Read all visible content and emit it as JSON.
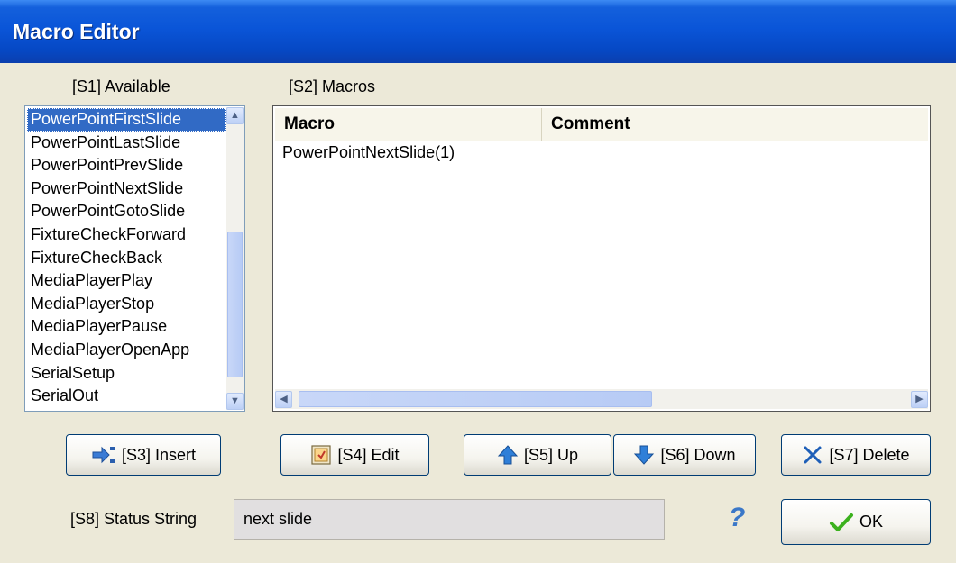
{
  "window": {
    "title": "Macro Editor"
  },
  "available": {
    "label": "[S1] Available",
    "items": [
      "PowerPointFirstSlide",
      "PowerPointLastSlide",
      "PowerPointPrevSlide",
      "PowerPointNextSlide",
      "PowerPointGotoSlide",
      "FixtureCheckForward",
      "FixtureCheckBack",
      "MediaPlayerPlay",
      "MediaPlayerStop",
      "MediaPlayerPause",
      "MediaPlayerOpenApp",
      "SerialSetup",
      "SerialOut"
    ],
    "selected_index": 0
  },
  "macros": {
    "label": "[S2] Macros",
    "columns": [
      "Macro",
      "Comment"
    ],
    "rows": [
      {
        "macro": "PowerPointNextSlide(1)",
        "comment": ""
      }
    ]
  },
  "buttons": {
    "insert": "[S3] Insert",
    "edit": "[S4] Edit",
    "up": "[S5] Up",
    "down": "[S6] Down",
    "delete": "[S7] Delete",
    "ok": "OK"
  },
  "status": {
    "label": "[S8] Status String",
    "value": "next slide"
  },
  "help": {
    "glyph": "?"
  },
  "colors": {
    "title_bar": "#0a55d8",
    "selection": "#316ac5",
    "ok_check": "#3cb11e",
    "help": "#3b78c8"
  }
}
